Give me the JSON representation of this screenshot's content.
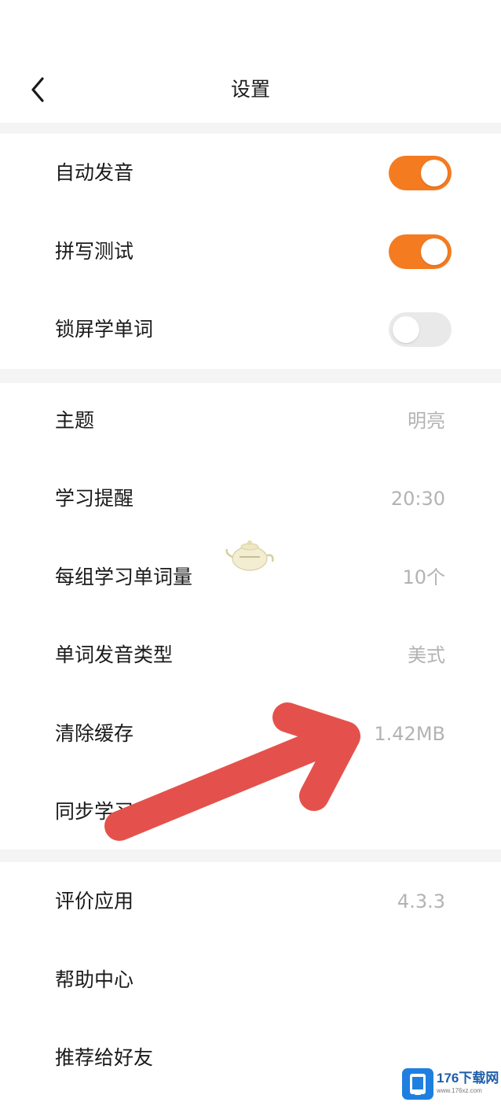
{
  "header": {
    "title": "设置",
    "back_icon": "chevron-left-icon"
  },
  "toggles_section": [
    {
      "label": "自动发音",
      "enabled": true
    },
    {
      "label": "拼写测试",
      "enabled": true
    },
    {
      "label": "锁屏学单词",
      "enabled": false
    }
  ],
  "preferences_section": [
    {
      "label": "主题",
      "value": "明亮"
    },
    {
      "label": "学习提醒",
      "value": "20:30"
    },
    {
      "label": "每组学习单词量",
      "value": "10个"
    },
    {
      "label": "单词发音类型",
      "value": "美式"
    },
    {
      "label": "清除缓存",
      "value": "1.42MB"
    },
    {
      "label": "同步学习",
      "value": ""
    }
  ],
  "about_section": [
    {
      "label": "评价应用",
      "value": "4.3.3"
    },
    {
      "label": "帮助中心",
      "value": ""
    },
    {
      "label": "推荐给好友",
      "value": ""
    }
  ],
  "colors": {
    "toggle_on": "#f47b20",
    "toggle_off": "#e9e9e9",
    "value_text": "#b3b3b3",
    "annotation_arrow": "#e4514c",
    "section_divider": "#f4f4f4"
  },
  "overlay": {
    "annotation": "red-arrow-icon",
    "sticker": "teapot-icon",
    "watermark_text": "176下载网",
    "watermark_sub": "www.176xz.com"
  }
}
